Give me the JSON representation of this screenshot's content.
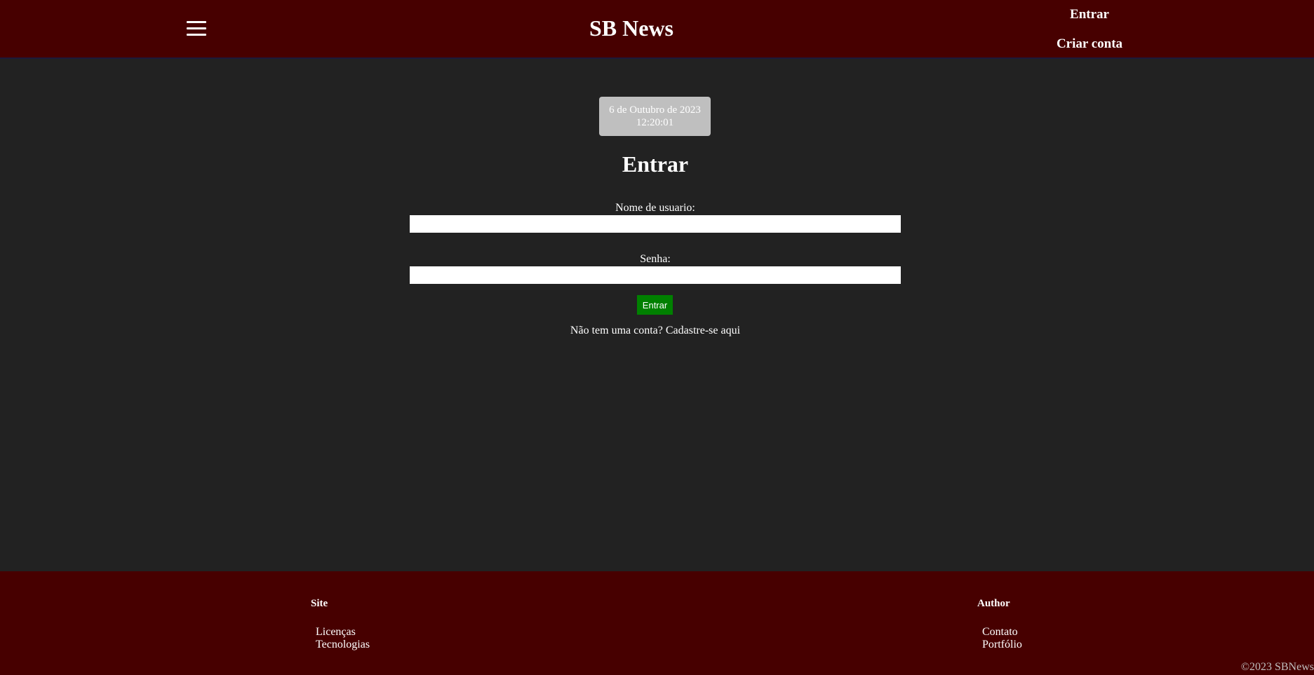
{
  "header": {
    "menu_icon": "hamburger-menu-icon",
    "title": "SB News",
    "login_label": "Entrar",
    "signup_label": "Criar conta"
  },
  "clock": {
    "date": "6 de Outubro de 2023",
    "time": "12:20:01"
  },
  "login_form": {
    "title": "Entrar",
    "username_label": "Nome de usuario:",
    "username_value": "",
    "password_label": "Senha:",
    "password_value": "",
    "submit_label": "Entrar",
    "no_account_text": "Não tem uma conta?",
    "signup_link": "Cadastre-se aqui"
  },
  "footer": {
    "site_heading": "Site",
    "site_links": [
      "Licenças",
      "Tecnologias"
    ],
    "author_heading": "Author",
    "author_links": [
      "Contato",
      "Portfólio"
    ],
    "copyright": "©2023 SBNews"
  },
  "colors": {
    "header_bg": "#470000",
    "page_bg": "#222222",
    "clock_bg": "#bfbfbf",
    "submit_bg": "#008000",
    "footer_bg": "#470000"
  }
}
